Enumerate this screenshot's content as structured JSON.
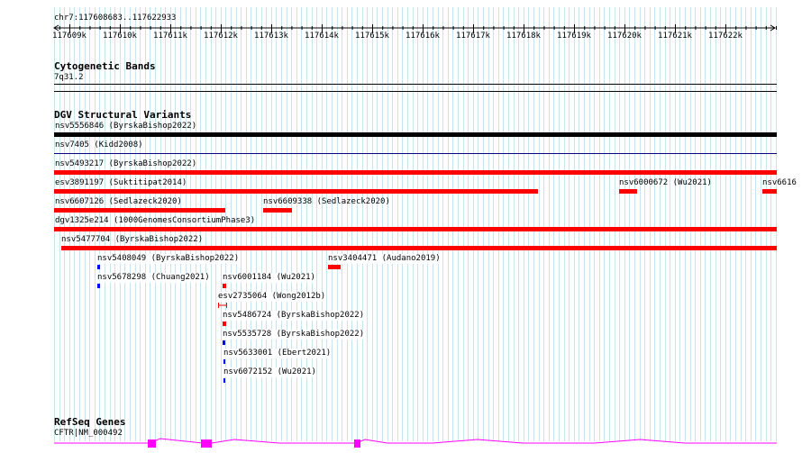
{
  "ruler": {
    "location": "chr7:117608683..117622933",
    "ticks": [
      "117609k",
      "117610k",
      "117611k",
      "117612k",
      "117613k",
      "117614k",
      "117615k",
      "117616k",
      "117617k",
      "117618k",
      "117619k",
      "117620k",
      "117621k",
      "117622k"
    ]
  },
  "tracks": {
    "cytoband": {
      "title": "Cytogenetic Bands",
      "band": "7q31.2"
    },
    "dgv": {
      "title": "DGV Structural Variants",
      "features": [
        {
          "label": "nsv5556846 (ByrskaBishop2022)",
          "color": "#000000"
        },
        {
          "label": "nsv7405 (Kidd2008)",
          "color": "#000080"
        },
        {
          "label": "nsv5493217 (ByrskaBishop2022)",
          "color": "#ff0000"
        },
        {
          "label": "esv3891197 (Suktitipat2014)",
          "color": "#ff0000"
        },
        {
          "label": "nsv6000672 (Wu2021)",
          "color": "#ff0000"
        },
        {
          "label": "nsv6616",
          "color": "#ff0000"
        },
        {
          "label": "nsv6607126 (Sedlazeck2020)",
          "color": "#ff0000"
        },
        {
          "label": "nsv6609338 (Sedlazeck2020)",
          "color": "#ff0000"
        },
        {
          "label": "dgv1325e214 (1000GenomesConsortiumPhase3)",
          "color": "#ff0000"
        },
        {
          "label": "nsv5477704 (ByrskaBishop2022)",
          "color": "#ff0000"
        },
        {
          "label": "nsv5408049 (ByrskaBishop2022)",
          "color": "#0000ff"
        },
        {
          "label": "nsv3404471 (Audano2019)",
          "color": "#ff0000"
        },
        {
          "label": "nsv5678298 (Chuang2021)",
          "color": "#0000ff"
        },
        {
          "label": "nsv6001184 (Wu2021)",
          "color": "#ff0000"
        },
        {
          "label": "esv2735064 (Wong2012b)",
          "color": "#ff0000"
        },
        {
          "label": "nsv5486724 (ByrskaBishop2022)",
          "color": "#ff0000"
        },
        {
          "label": "nsv5535728 (ByrskaBishop2022)",
          "color": "#0000ff"
        },
        {
          "label": "nsv5633001 (Ebert2021)",
          "color": "#0000ff"
        },
        {
          "label": "nsv6072152 (Wu2021)",
          "color": "#0000ff"
        }
      ]
    },
    "refseq": {
      "title": "RefSeq Genes",
      "gene": "CFTR|NM_000492",
      "color": "#ff00ff"
    }
  }
}
